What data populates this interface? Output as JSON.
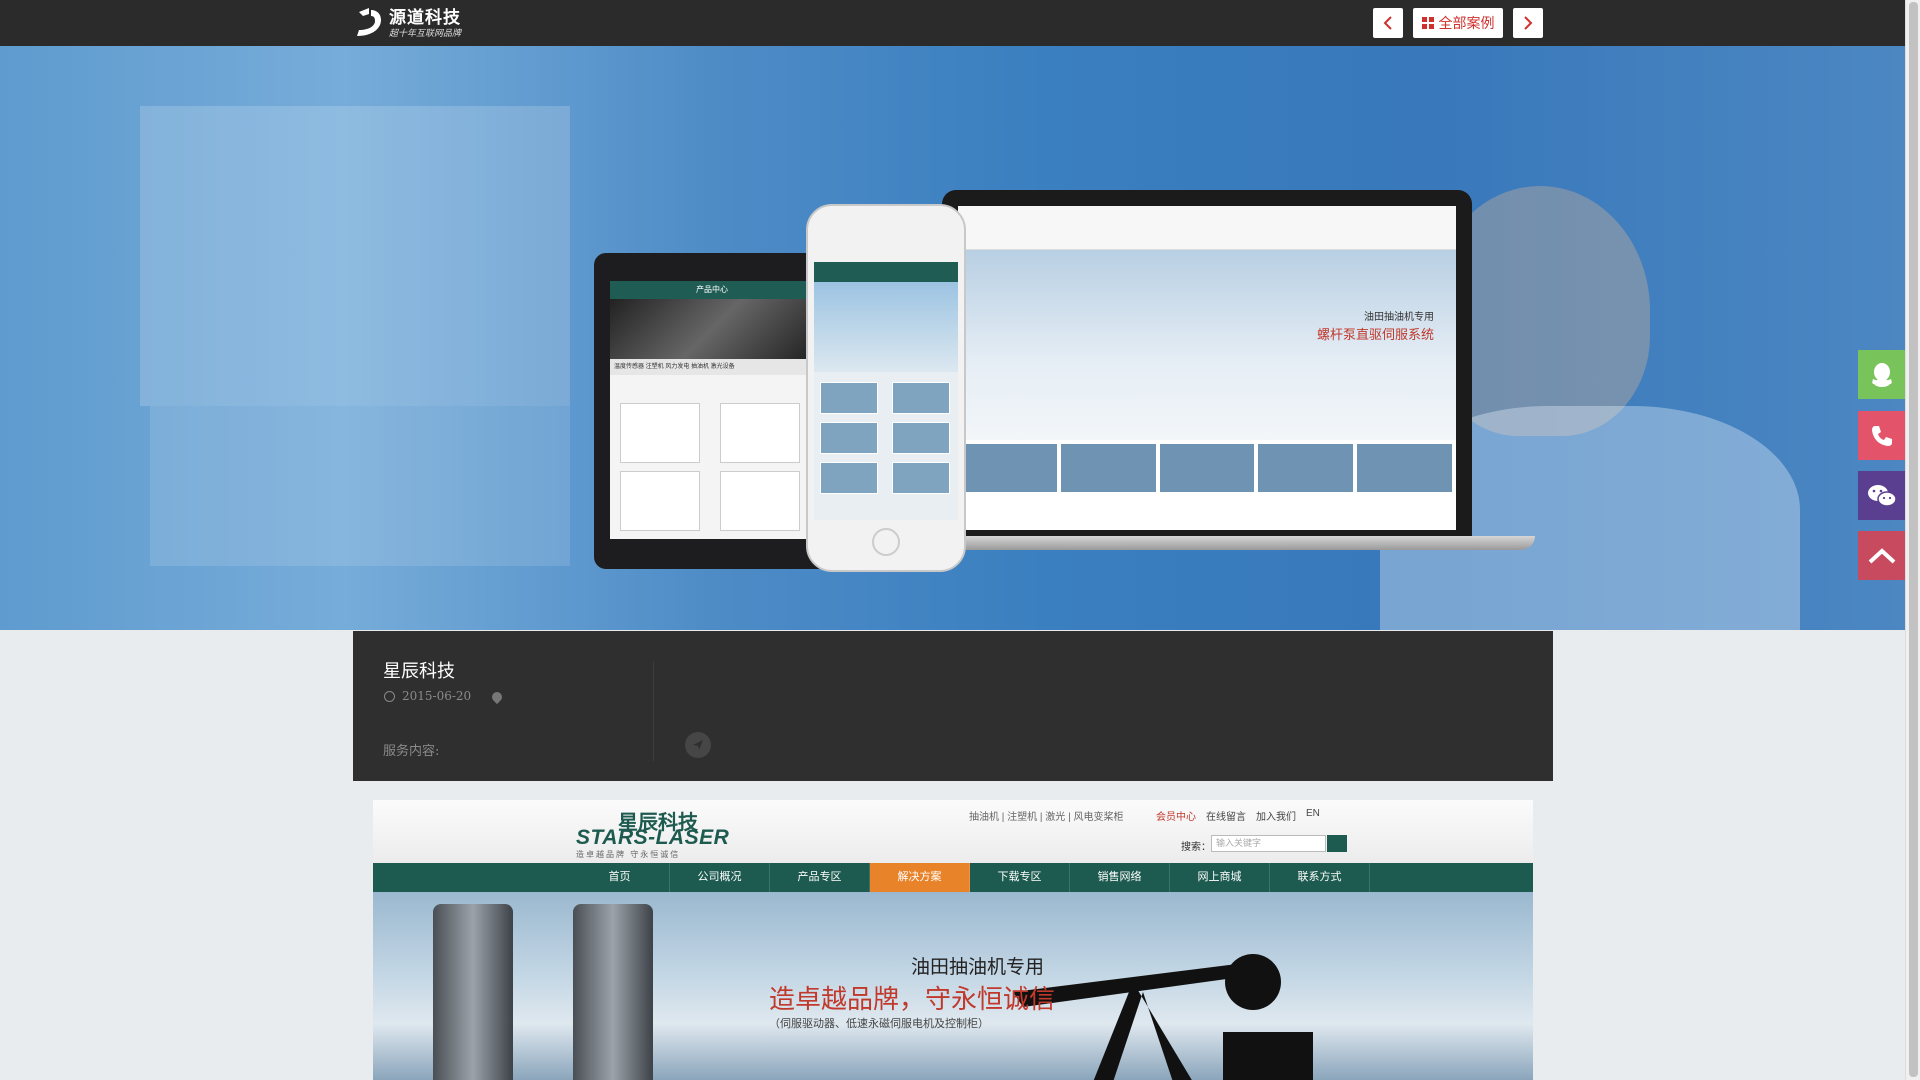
{
  "topbar": {
    "logo_name": "源道科技",
    "logo_sub": "超十年互联网品牌",
    "prev_label": "‹",
    "all_cases_label": "全部案例",
    "next_label": "›"
  },
  "hero": {
    "tablet_header": "产品中心",
    "tablet_tabs": "温度传感器  注塑机  风力发电  抽油机  激光设备",
    "laptop_line1": "油田抽油机专用",
    "laptop_line2": "螺杆泵直驱伺服系统"
  },
  "info": {
    "title": "星辰科技",
    "date": "2015-06-20",
    "service_label": "服务内容:"
  },
  "preview": {
    "logo_cn": "星辰科技",
    "logo_en": "STARS-LASER",
    "logo_slogan": "造卓越品牌  守永恒诚信",
    "top_links": "抽油机  |  注塑机  |  激光  |  风电变桨柜",
    "member": "会员中心",
    "message": "在线留言",
    "join": "加入我们",
    "lang": "EN",
    "search_label": "搜索：",
    "search_placeholder": "输入关键字",
    "nav": [
      {
        "label": "首页"
      },
      {
        "label": "公司概况"
      },
      {
        "label": "产品专区"
      },
      {
        "label": "解决方案"
      },
      {
        "label": "下载专区"
      },
      {
        "label": "销售网络"
      },
      {
        "label": "网上商城"
      },
      {
        "label": "联系方式"
      }
    ],
    "active_nav": "解决方案",
    "banner_line1": "油田抽油机专用",
    "banner_line2": "造卓越品牌，守永恒诚信",
    "banner_line3": "（伺服驱动器、低速永磁伺服电机及控制柜）"
  },
  "side_buttons": [
    "qq-icon",
    "phone-icon",
    "wechat-icon",
    "top-arrow-icon"
  ],
  "colors": {
    "accent": "#d0312d",
    "topbar": "#2b2b2b",
    "brand_green": "#1d5a4f",
    "nav_active": "#e8832a",
    "qq": "#78c35a",
    "phone": "#e35369",
    "wechat": "#5a3e8f",
    "top": "#c74a5e"
  }
}
